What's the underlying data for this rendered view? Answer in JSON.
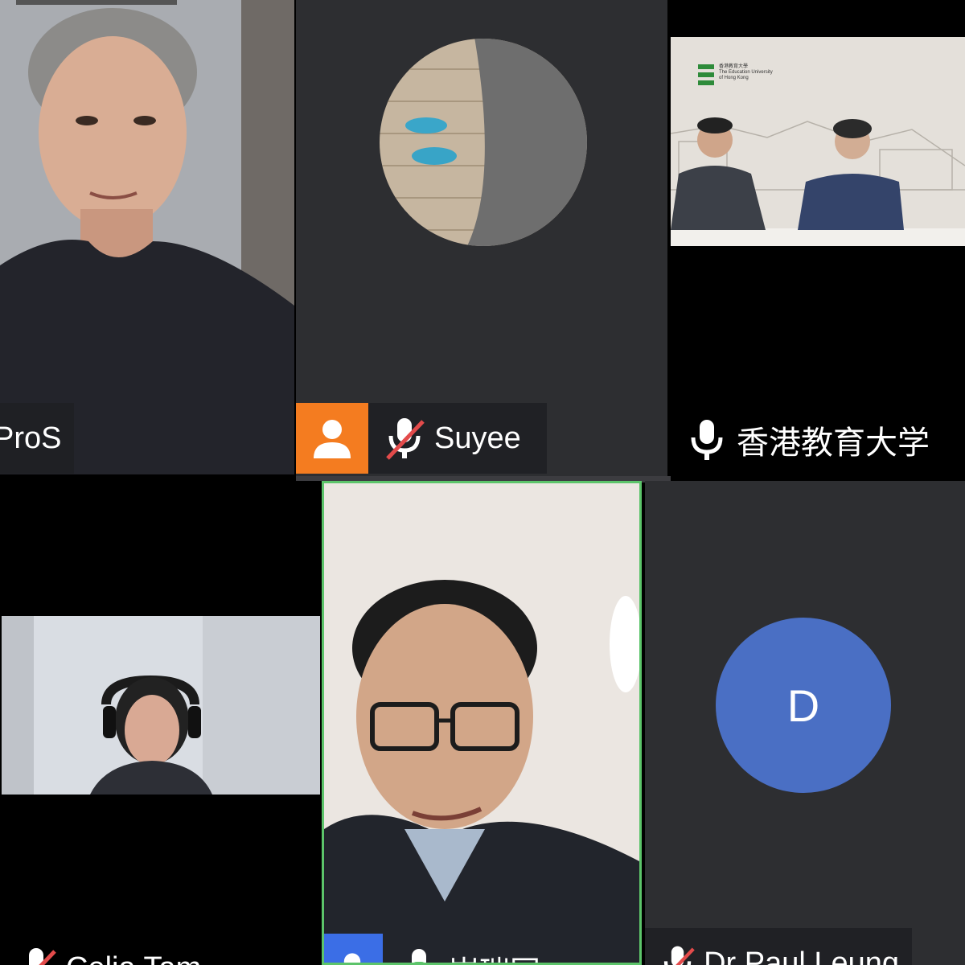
{
  "participants": [
    {
      "name": "ProS",
      "mic": "none",
      "video": "on"
    },
    {
      "name": "Suyee",
      "mic": "muted",
      "video": "avatar"
    },
    {
      "name": "香港教育大学",
      "mic": "on",
      "video": "on"
    },
    {
      "name": "Celia Tam",
      "mic": "muted",
      "video": "on"
    },
    {
      "name": "崔瑞国",
      "mic": "speaking",
      "video": "on",
      "active_speaker": true
    },
    {
      "name": "Dr Paul Leung",
      "mic": "muted",
      "video": "off",
      "avatar_letter": "D",
      "avatar_color": "#4a6fc4"
    }
  ],
  "hkeduhk_banner": {
    "line1": "香港教育大學",
    "line2": "The Education University",
    "line3": "of Hong Kong"
  },
  "colors": {
    "tile_bg": "#2d2e31",
    "namebar_bg": "#202124",
    "profile_badge": "#f47c20",
    "profile_badge_blue": "#3b6ee6",
    "active_border": "#5cc46a",
    "muted_red": "#e34b4b",
    "avatar_blue": "#4a6fc4"
  },
  "icons": [
    "mic-muted-icon",
    "mic-icon",
    "person-icon"
  ]
}
